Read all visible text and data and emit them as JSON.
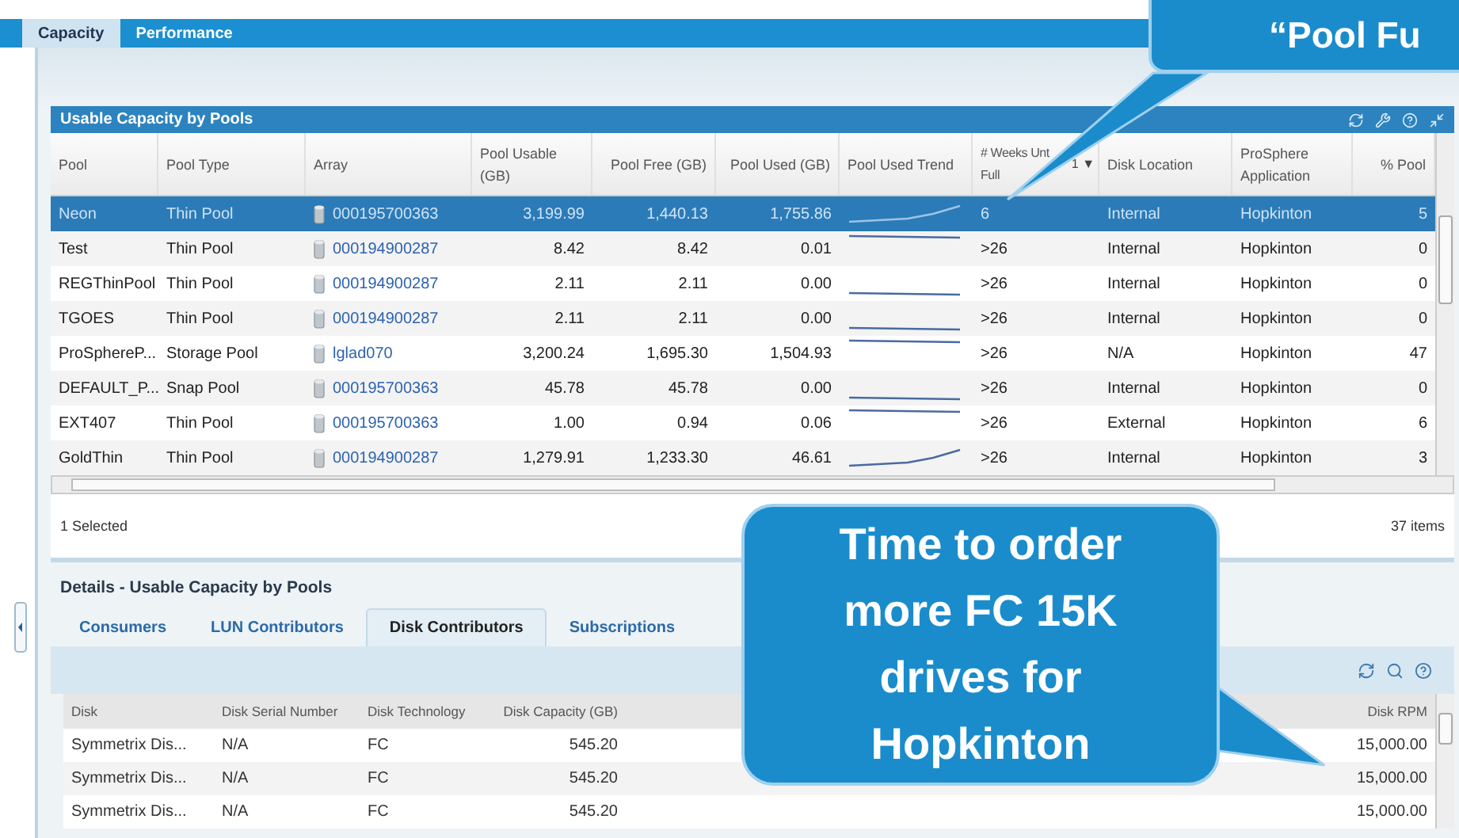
{
  "top_tabs": [
    {
      "label": "Capacity",
      "selected": true
    },
    {
      "label": "Performance",
      "selected": false
    }
  ],
  "pools_panel": {
    "title": "Usable Capacity by Pools",
    "columns": [
      {
        "label": "Pool"
      },
      {
        "label": "Pool Type"
      },
      {
        "label": "Array"
      },
      {
        "label": "Pool Usable (GB)"
      },
      {
        "label": "Pool Free (GB)"
      },
      {
        "label": "Pool Used (GB)"
      },
      {
        "label": "Pool Used Trend"
      },
      {
        "label": "# Weeks Unt Full",
        "sort": "1 ▼"
      },
      {
        "label": "Disk Location"
      },
      {
        "label": "ProSphere Application"
      },
      {
        "label": "% Pool"
      }
    ],
    "rows": [
      {
        "cells": [
          "Neon",
          "Thin Pool",
          "000195700363",
          "3,199.99",
          "1,440.13",
          "1,755.86",
          "",
          "6",
          "Internal",
          "Hopkinton",
          "5"
        ],
        "kind": "rising",
        "selected": true
      },
      {
        "cells": [
          "Test",
          "Thin Pool",
          "000194900287",
          "8.42",
          "8.42",
          "0.01",
          "",
          ">26",
          "Internal",
          "Hopkinton",
          "0"
        ],
        "kind": "high",
        "selected": false
      },
      {
        "cells": [
          "REGThinPool",
          "Thin Pool",
          "000194900287",
          "2.11",
          "2.11",
          "0.00",
          "",
          ">26",
          "Internal",
          "Hopkinton",
          "0"
        ],
        "kind": "low",
        "selected": false
      },
      {
        "cells": [
          "TGOES",
          "Thin Pool",
          "000194900287",
          "2.11",
          "2.11",
          "0.00",
          "",
          ">26",
          "Internal",
          "Hopkinton",
          "0"
        ],
        "kind": "low",
        "selected": false
      },
      {
        "cells": [
          "ProSphereP...",
          "Storage Pool",
          "lglad070",
          "3,200.24",
          "1,695.30",
          "1,504.93",
          "",
          ">26",
          "N/A",
          "Hopkinton",
          "47"
        ],
        "kind": "high",
        "selected": false
      },
      {
        "cells": [
          "DEFAULT_P...",
          "Snap Pool",
          "000195700363",
          "45.78",
          "45.78",
          "0.00",
          "",
          ">26",
          "Internal",
          "Hopkinton",
          "0"
        ],
        "kind": "low",
        "selected": false
      },
      {
        "cells": [
          "EXT407",
          "Thin Pool",
          "000195700363",
          "1.00",
          "0.94",
          "0.06",
          "",
          ">26",
          "External",
          "Hopkinton",
          "6"
        ],
        "kind": "high",
        "selected": false
      },
      {
        "cells": [
          "GoldThin",
          "Thin Pool",
          "000194900287",
          "1,279.91",
          "1,233.30",
          "46.61",
          "",
          ">26",
          "Internal",
          "Hopkinton",
          "3"
        ],
        "kind": "rising",
        "selected": false
      }
    ],
    "selection_status": "1 Selected",
    "item_count": "37 items"
  },
  "details_panel": {
    "title": "Details - Usable Capacity by Pools",
    "tabs": [
      {
        "label": "Consumers",
        "selected": false
      },
      {
        "label": "LUN Contributors",
        "selected": false
      },
      {
        "label": "Disk Contributors",
        "selected": true
      },
      {
        "label": "Subscriptions",
        "selected": false
      }
    ],
    "columns": [
      "Disk",
      "Disk Serial Number",
      "Disk Technology",
      "Disk Capacity (GB)",
      "Disk RPM"
    ],
    "rows": [
      {
        "cells": [
          "Symmetrix Dis...",
          "N/A",
          "FC",
          "545.20",
          "15,000.00"
        ]
      },
      {
        "cells": [
          "Symmetrix Dis...",
          "N/A",
          "FC",
          "545.20",
          "15,000.00"
        ]
      },
      {
        "cells": [
          "Symmetrix Dis...",
          "N/A",
          "FC",
          "545.20",
          "15,000.00"
        ]
      }
    ]
  },
  "callouts": [
    {
      "text": "“Pool Fu"
    },
    {
      "text": "Time to order more FC 15K drives for Hopkinton"
    }
  ]
}
